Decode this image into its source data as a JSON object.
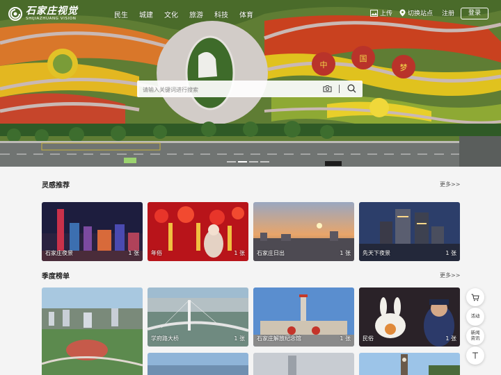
{
  "brand": {
    "name_cn": "石家庄视觉",
    "name_en": "SHIJIAZHUANG VISION"
  },
  "nav": [
    "民生",
    "城建",
    "文化",
    "旅游",
    "科技",
    "体育"
  ],
  "toolbar": {
    "upload": "上传",
    "switch_site": "切换站点",
    "register": "注册",
    "login": "登录"
  },
  "hero": {
    "search_placeholder": "请输入关键词进行搜索",
    "flower_chars": [
      "中",
      "国",
      "梦"
    ]
  },
  "inspiration": {
    "title": "灵感推荐",
    "more": "更多>>",
    "cards": [
      {
        "caption": "石家庄夜景",
        "count": "1 张"
      },
      {
        "caption": "年俗",
        "count": "1 张"
      },
      {
        "caption": "石家庄日出",
        "count": "1 张"
      },
      {
        "caption": "先天下夜景",
        "count": "1 张"
      }
    ]
  },
  "season": {
    "title": "季度榜单",
    "more": "更多>>",
    "cards": [
      {
        "caption": "",
        "count": ""
      },
      {
        "caption": "学府路大桥",
        "count": "1 张"
      },
      {
        "caption": "石家庄解放纪念馆",
        "count": "1 张"
      },
      {
        "caption": "民俗",
        "count": "1 张"
      }
    ]
  },
  "floating": {
    "cart": "cart-icon",
    "activity": "活动",
    "news": "新闻资讯",
    "top": "top-icon"
  }
}
